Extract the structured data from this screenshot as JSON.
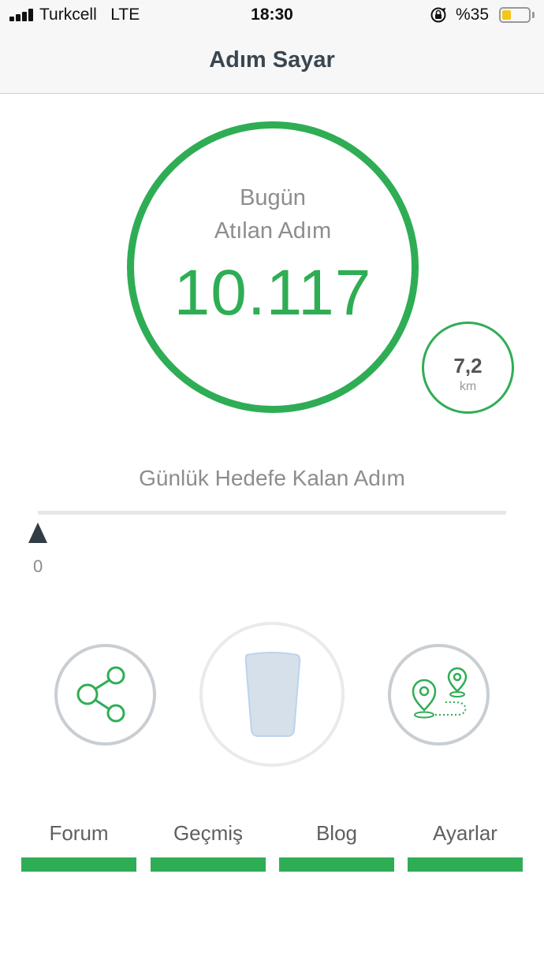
{
  "status_bar": {
    "carrier": "Turkcell",
    "network": "LTE",
    "time": "18:30",
    "battery_percent": "%35",
    "battery_level": 0.35,
    "icons": [
      "signal-icon",
      "orientation-lock-icon",
      "battery-icon"
    ]
  },
  "header": {
    "title": "Adım Sayar"
  },
  "steps": {
    "label_line1": "Bugün",
    "label_line2": "Atılan Adım",
    "count": "10.117"
  },
  "distance": {
    "value": "7,2",
    "unit": "km"
  },
  "goal": {
    "label": "Günlük Hedefe Kalan Adım",
    "remaining": "0"
  },
  "actions": [
    {
      "name": "share",
      "icon": "share-icon"
    },
    {
      "name": "water",
      "icon": "water-glass-icon"
    },
    {
      "name": "route",
      "icon": "route-map-icon"
    }
  ],
  "bottom_nav": [
    {
      "label": "Forum"
    },
    {
      "label": "Geçmiş"
    },
    {
      "label": "Blog"
    },
    {
      "label": "Ayarlar"
    }
  ],
  "colors": {
    "accent": "#2fad55",
    "title": "#3a4650",
    "muted_text": "#8d8d8d",
    "ring_gray": "#c9ced3",
    "battery": "#f5c518"
  }
}
